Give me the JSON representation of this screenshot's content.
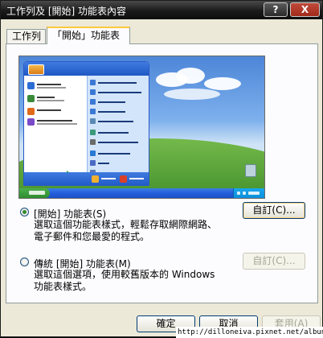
{
  "window": {
    "title": "工作列及 [開始] 功能表內容",
    "help_label": "?",
    "close_label": "X"
  },
  "tabs": [
    {
      "label": "工作列",
      "selected": false
    },
    {
      "label": "「開始」功能表",
      "selected": true
    }
  ],
  "options": {
    "start_menu": {
      "label": "[開始] 功能表(S)",
      "description": "選取這個功能表樣式，輕鬆存取網際網路、電子郵件和您最愛的程式。",
      "selected": true,
      "customize_label": "自訂(C)..."
    },
    "classic_menu": {
      "label": "傳統 [開始] 功能表(M)",
      "description": "選取這個選項，使用較舊版本的 Windows 功能表樣式。",
      "selected": false,
      "customize_label": "自訂(C)..."
    }
  },
  "buttons": {
    "ok_label": "確定",
    "cancel_label": "取消",
    "apply_label": "套用(A)"
  },
  "watermark": "http://dilloneiva.pixnet.net/albun",
  "colors": {
    "title_bar": "#1a1a1a",
    "close_button": "#b03a2a",
    "dialog_bg": "#ece9d8",
    "selected_tab_accent": "#ffc83c",
    "radio_dot": "#2f8a2f",
    "button_border": "#003c74"
  }
}
